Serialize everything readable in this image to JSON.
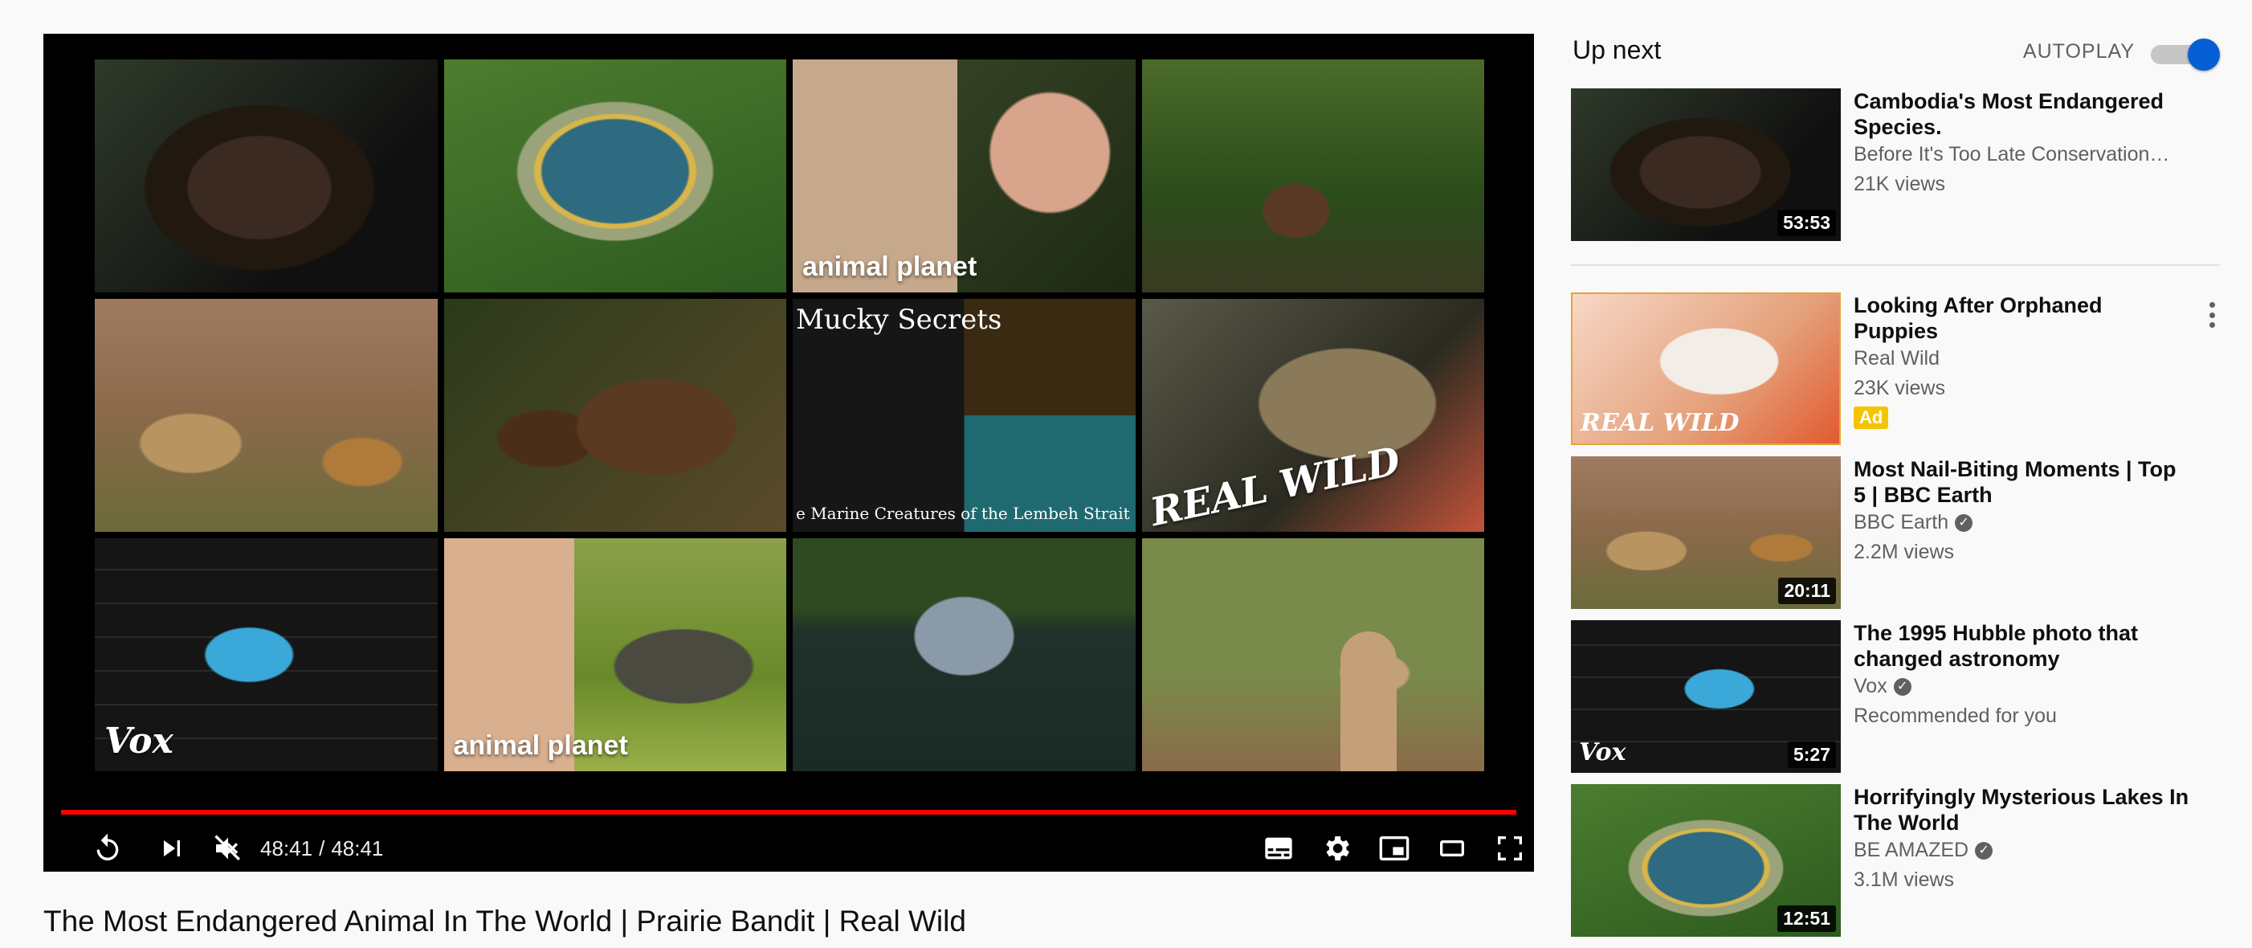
{
  "player": {
    "endscreen": [
      {
        "kind": "bear",
        "label": ""
      },
      {
        "kind": "lake",
        "label": ""
      },
      {
        "kind": "loris",
        "label": "animal planet"
      },
      {
        "kind": "jungle",
        "label": ""
      },
      {
        "kind": "cheetah",
        "label": ""
      },
      {
        "kind": "bears",
        "label": ""
      },
      {
        "kind": "mucky",
        "title": "Mucky Secrets",
        "subtitle": "e Marine Creatures of the Lembeh Strait"
      },
      {
        "kind": "ocelot",
        "label": "REAL WILD"
      },
      {
        "kind": "vox",
        "label": "Vox"
      },
      {
        "kind": "irwin",
        "label": "animal planet"
      },
      {
        "kind": "hippo",
        "label": ""
      },
      {
        "kind": "prairie",
        "label": ""
      }
    ],
    "time_current": "48:41",
    "time_separator": "/",
    "time_total": "48:41",
    "progress": 1.0,
    "progress_color": "#ff0000",
    "icons": [
      "replay-icon",
      "next-icon",
      "muted-icon",
      "subtitles-icon",
      "settings-icon",
      "miniplayer-icon",
      "theater-icon",
      "fullscreen-icon"
    ]
  },
  "video": {
    "title": "The Most Endangered Animal In The World | Prairie Bandit | Real Wild"
  },
  "sidebar": {
    "up_next": "Up next",
    "autoplay_label": "AUTOPLAY",
    "autoplay_on": true,
    "accent": "#065fd4",
    "items": [
      {
        "title": "Cambodia's Most Endangered Species.",
        "channel": "Before It's Too Late Conservation…",
        "views": "21K views",
        "duration": "53:53",
        "verified": false
      },
      {
        "title": "Looking After Orphaned Puppies",
        "channel": "Real Wild",
        "views": "23K views",
        "badge": "Ad",
        "watermark": "REAL WILD"
      },
      {
        "title": "Most Nail-Biting Moments | Top 5 | BBC Earth",
        "channel": "BBC Earth",
        "views": "2.2M views",
        "duration": "20:11",
        "verified": true
      },
      {
        "title": "The 1995 Hubble photo that changed astronomy",
        "channel": "Vox",
        "views": "Recommended for you",
        "duration": "5:27",
        "verified": true,
        "watermark": "Vox"
      },
      {
        "title": "Horrifyingly Mysterious Lakes In The World",
        "channel": "BE AMAZED",
        "views": "3.1M views",
        "duration": "12:51",
        "verified": true
      }
    ]
  }
}
